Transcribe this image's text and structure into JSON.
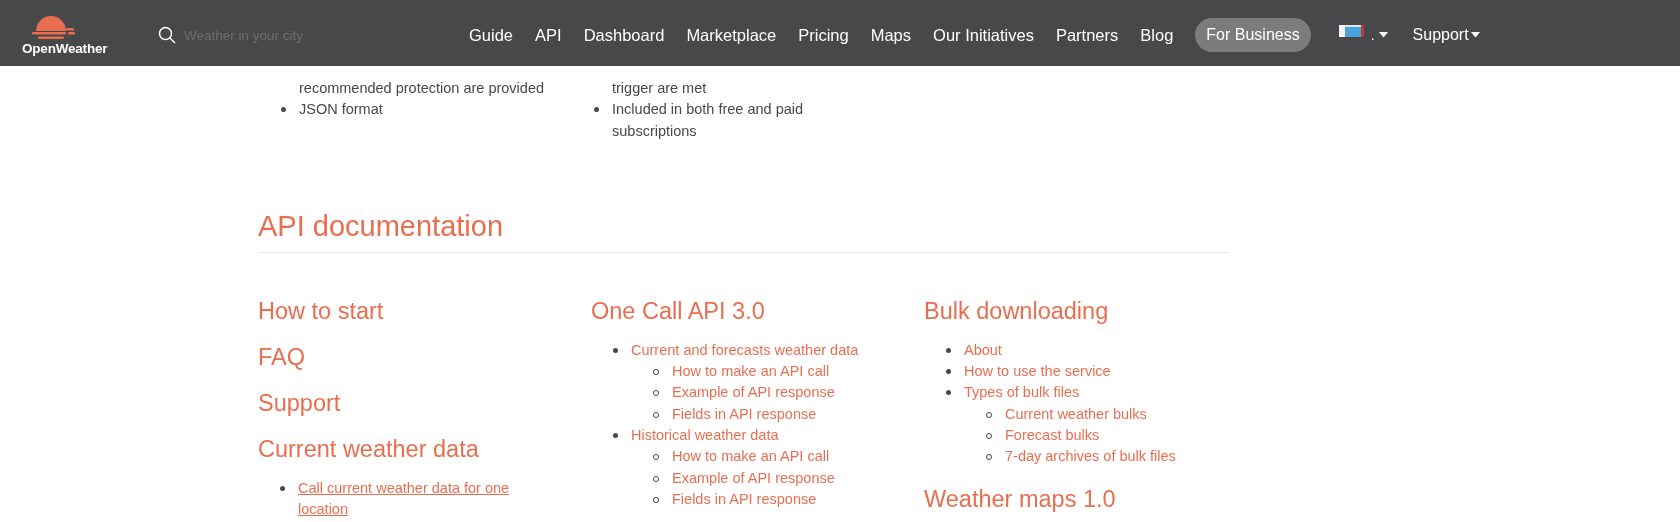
{
  "header": {
    "logo": "OpenWeather",
    "search": {
      "placeholder": "Weather in your city"
    },
    "nav": [
      "Guide",
      "API",
      "Dashboard",
      "Marketplace",
      "Pricing",
      "Maps",
      "Our Initiatives",
      "Partners",
      "Blog"
    ],
    "business_button": "For Business",
    "language": ".",
    "support": "Support"
  },
  "features": [
    {
      "items": [
        {
          "text": "recommended protection are provided",
          "bullet": false
        },
        {
          "text": "JSON format",
          "bullet": true
        }
      ]
    },
    {
      "items": [
        {
          "text": "trigger are met",
          "bullet": false
        },
        {
          "text": "Included in both free and paid subscriptions",
          "bullet": true
        }
      ]
    }
  ],
  "docs": {
    "title": "API documentation",
    "columns": [
      [
        {
          "title": "How to start"
        },
        {
          "title": "FAQ"
        },
        {
          "title": "Support"
        },
        {
          "title": "Current weather data",
          "items": [
            {
              "text": "Call current weather data for one location",
              "underlined": true
            }
          ]
        }
      ],
      [
        {
          "title": "One Call API 3.0",
          "items": [
            {
              "text": "Current and forecasts weather data",
              "underlined": false,
              "children": [
                "How to make an API call",
                "Example of API response",
                "Fields in API response"
              ]
            },
            {
              "text": "Historical weather data",
              "underlined": false,
              "children": [
                "How to make an API call",
                "Example of API response",
                "Fields in API response"
              ]
            }
          ]
        }
      ],
      [
        {
          "title": "Bulk downloading",
          "items": [
            {
              "text": "About",
              "underlined": false
            },
            {
              "text": "How to use the service",
              "underlined": false
            },
            {
              "text": "Types of bulk files",
              "underlined": false,
              "children": [
                "Current weather bulks",
                "Forecast bulks",
                "7-day archives of bulk files"
              ]
            }
          ]
        },
        {
          "title": "Weather maps 1.0"
        }
      ]
    ]
  }
}
